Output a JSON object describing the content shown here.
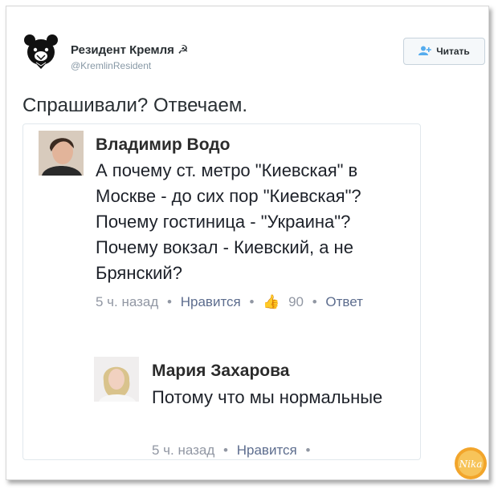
{
  "tweet": {
    "author_name": "Резидент Кремля ☭",
    "author_handle": "@KremlinResident",
    "follow_label": "Читать",
    "text": "Спрашивали? Отвечаем."
  },
  "embed": {
    "comment1": {
      "author": "Владимир Водо",
      "text": "А почему ст. метро \"Киевская\" в Москве - до сих пор \"Киевская\"? Почему гостиница - \"Украина\"? Почему вокзал - Киевский, а не Брянский?",
      "time": "5 ч. назад",
      "dot": "•",
      "like_label": "Нравится",
      "like_icon": "👍",
      "like_count": "90",
      "reply_label": "Ответ"
    },
    "comment2": {
      "author": "Мария Захарова",
      "text": "Потому что мы нормальные",
      "time": "5 ч. назад",
      "dot": "•",
      "like_label": "Нравится"
    }
  },
  "watermark": {
    "text": "Nika"
  },
  "colors": {
    "accent": "#55acee",
    "text": "#292f33",
    "muted": "#9197a3",
    "link": "#5d6d8e"
  }
}
